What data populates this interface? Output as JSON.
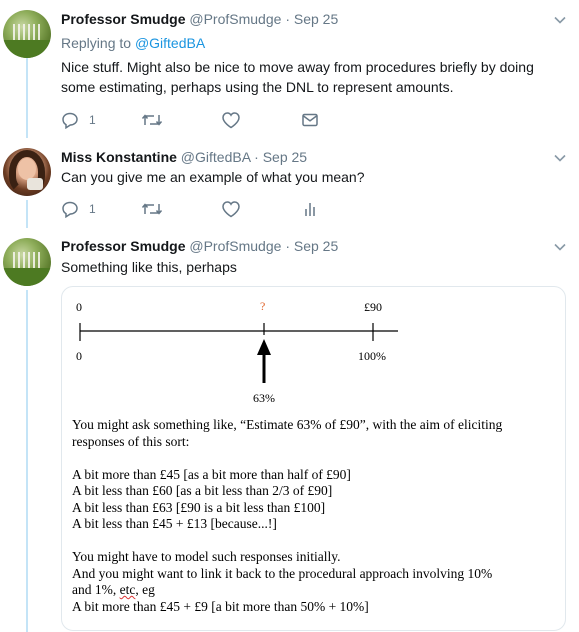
{
  "tweets": [
    {
      "name": "Professor Smudge",
      "handle": "@ProfSmudge",
      "sep": "·",
      "date": "Sep 25",
      "reply_prefix": "Replying to ",
      "reply_to": "@GiftedBA",
      "text_lines": [
        "Nice stuff. Might also be nice to move away from procedures briefly by doing",
        "some estimating, perhaps using the DNL to represent amounts."
      ],
      "reply_count": "1",
      "actions": [
        "reply-icon",
        "retweet-icon",
        "like-icon",
        "dm-icon"
      ]
    },
    {
      "name": "Miss Konstantine",
      "handle": "@GiftedBA",
      "sep": "·",
      "date": "Sep 25",
      "text_lines": [
        "Can you give me an example of what you mean?"
      ],
      "reply_count": "1",
      "actions": [
        "reply-icon",
        "retweet-icon",
        "like-icon",
        "analytics-icon"
      ]
    },
    {
      "name": "Professor Smudge",
      "handle": "@ProfSmudge",
      "sep": "·",
      "date": "Sep 25",
      "text_lines": [
        "Something like this, perhaps"
      ]
    }
  ],
  "image": {
    "number_line": {
      "top_left": "0",
      "top_mid": "?",
      "top_right": "£90",
      "bottom_left": "0",
      "bottom_right": "100%",
      "arrow_label": "63%"
    },
    "lines": [
      "You might ask something like, “Estimate 63% of £90”, with the aim of eliciting",
      "responses of this sort:",
      "",
      "A bit more than £45 [as a bit more than half of £90]",
      "A bit less than £60 [as a bit less than 2/3 of £90]",
      "A bit less than £63 [£90 is a bit less than £100]",
      "A bit less than £45 + £13 [because...!]",
      "",
      "You might have to model such responses initially.",
      "And you might want to link it back to the procedural approach involving 10%",
      "and 1%, ",
      "A bit more than £45 + £9 [a bit more than 50% + 10%]"
    ],
    "etc_text": "etc",
    "eg_text": ", eg"
  },
  "colors": {
    "accent": "#1b95e0",
    "thread_line": "#c4e4f7",
    "muted": "#657786",
    "question_mark": "#e0632a"
  }
}
